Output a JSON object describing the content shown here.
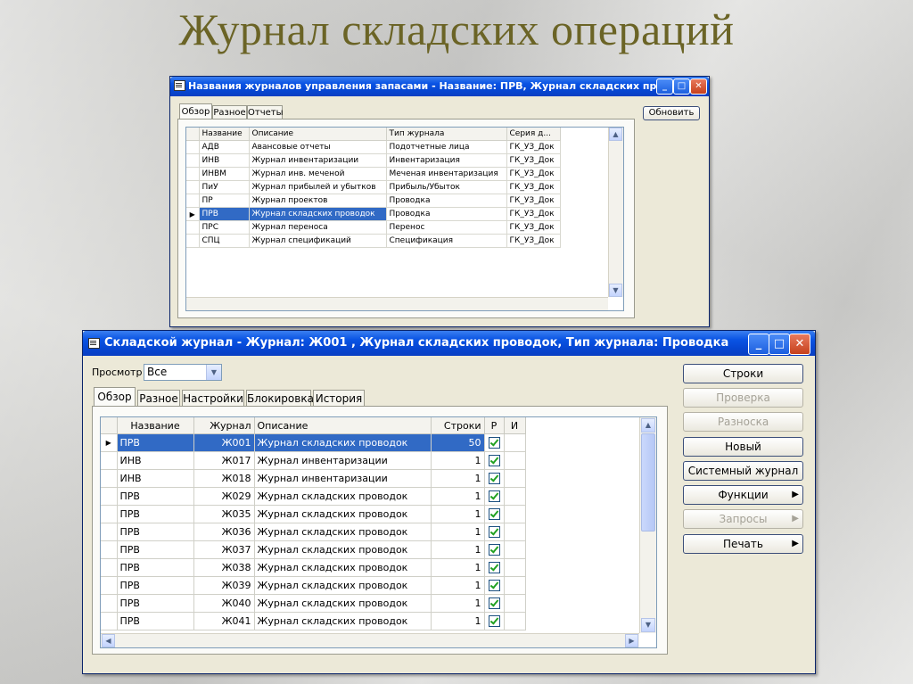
{
  "slide_title": "Журнал складских операций",
  "window1": {
    "title": "Названия журналов управления запасами - Название: ПРВ, Журнал складских проводок",
    "tabs": [
      "Обзор",
      "Разное",
      "Отчеты"
    ],
    "refresh_button": "Обновить",
    "columns": [
      "Название",
      "Описание",
      "Тип журнала",
      "Серия д..."
    ],
    "rows": [
      {
        "name": "АДВ",
        "desc": "Авансовые отчеты",
        "type": "Подотчетные лица",
        "series": "ГК_УЗ_Док"
      },
      {
        "name": "ИНВ",
        "desc": "Журнал инвентаризации",
        "type": "Инвентаризация",
        "series": "ГК_УЗ_Док"
      },
      {
        "name": "ИНВМ",
        "desc": "Журнал инв. меченой",
        "type": "Меченая инвентаризация",
        "series": "ГК_УЗ_Док"
      },
      {
        "name": "ПиУ",
        "desc": "Журнал прибылей и убытков",
        "type": "Прибыль/Убыток",
        "series": "ГК_УЗ_Док"
      },
      {
        "name": "ПР",
        "desc": "Журнал проектов",
        "type": "Проводка",
        "series": "ГК_УЗ_Док"
      },
      {
        "name": "ПРВ",
        "desc": "Журнал складских проводок",
        "type": "Проводка",
        "series": "ГК_УЗ_Док"
      },
      {
        "name": "ПРС",
        "desc": "Журнал переноса",
        "type": "Перенос",
        "series": "ГК_УЗ_Док"
      },
      {
        "name": "СПЦ",
        "desc": "Журнал спецификаций",
        "type": "Спецификация",
        "series": "ГК_УЗ_Док"
      }
    ],
    "selected_row": 5
  },
  "window2": {
    "title": "Складской журнал - Журнал: Ж001 , Журнал складских проводок, Тип журнала: Проводка",
    "view_label": "Просмотр",
    "view_value": "Все",
    "tabs": [
      "Обзор",
      "Разное",
      "Настройки",
      "Блокировка",
      "История"
    ],
    "columns": [
      "Название",
      "Журнал",
      "Описание",
      "Строки",
      "Р",
      "И"
    ],
    "rows": [
      {
        "name": "ПРВ",
        "journal": "Ж001",
        "desc": "Журнал складских проводок",
        "lines": "50",
        "p": true
      },
      {
        "name": "ИНВ",
        "journal": "Ж017",
        "desc": "Журнал инвентаризации",
        "lines": "1",
        "p": true
      },
      {
        "name": "ИНВ",
        "journal": "Ж018",
        "desc": "Журнал инвентаризации",
        "lines": "1",
        "p": true
      },
      {
        "name": "ПРВ",
        "journal": "Ж029",
        "desc": "Журнал складских проводок",
        "lines": "1",
        "p": true
      },
      {
        "name": "ПРВ",
        "journal": "Ж035",
        "desc": "Журнал складских проводок",
        "lines": "1",
        "p": true
      },
      {
        "name": "ПРВ",
        "journal": "Ж036",
        "desc": "Журнал складских проводок",
        "lines": "1",
        "p": true
      },
      {
        "name": "ПРВ",
        "journal": "Ж037",
        "desc": "Журнал складских проводок",
        "lines": "1",
        "p": true
      },
      {
        "name": "ПРВ",
        "journal": "Ж038",
        "desc": "Журнал складских проводок",
        "lines": "1",
        "p": true
      },
      {
        "name": "ПРВ",
        "journal": "Ж039",
        "desc": "Журнал складских проводок",
        "lines": "1",
        "p": true
      },
      {
        "name": "ПРВ",
        "journal": "Ж040",
        "desc": "Журнал складских проводок",
        "lines": "1",
        "p": true
      },
      {
        "name": "ПРВ",
        "journal": "Ж041",
        "desc": "Журнал складских проводок",
        "lines": "1",
        "p": true
      }
    ],
    "selected_row": 0,
    "buttons": [
      {
        "label": "Строки",
        "enabled": true,
        "submenu": false
      },
      {
        "label": "Проверка",
        "enabled": false,
        "submenu": false
      },
      {
        "label": "Разноска",
        "enabled": false,
        "submenu": false
      },
      {
        "label": "Новый",
        "enabled": true,
        "submenu": false
      },
      {
        "label": "Системный журнал",
        "enabled": true,
        "submenu": false
      },
      {
        "label": "Функции",
        "enabled": true,
        "submenu": true
      },
      {
        "label": "Запросы",
        "enabled": false,
        "submenu": true
      },
      {
        "label": "Печать",
        "enabled": true,
        "submenu": true
      }
    ]
  },
  "colors": {
    "selection": "#316ac5",
    "titlebar": "#0a54e4",
    "title_text": "#6b6426"
  }
}
